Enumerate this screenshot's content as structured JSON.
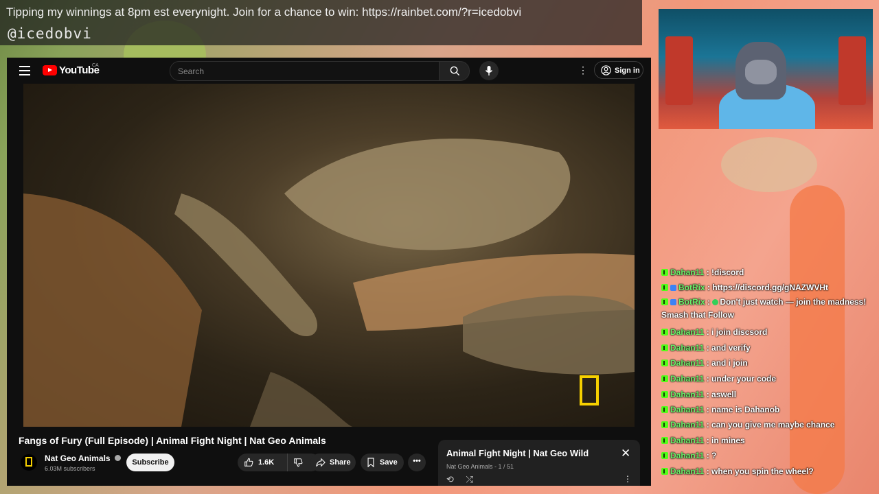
{
  "overlay": {
    "banner_line1": "Tipping my winnings at 8pm est everynight. Join for a chance to win: https://rainbet.com/?r=icedobvi",
    "banner_line2": "@icedobvi"
  },
  "youtube": {
    "logo_text": "YouTube",
    "region": "CA",
    "search_placeholder": "Search",
    "sign_in": "Sign in",
    "video_title": "Fangs of Fury (Full Episode) | Animal Fight Night | Nat Geo Animals",
    "channel_name": "Nat Geo Animals",
    "subscribers": "6.03M subscribers",
    "subscribe_label": "Subscribe",
    "like_count": "1.6K",
    "share_label": "Share",
    "save_label": "Save",
    "playlist": {
      "title": "Animal Fight Night | Nat Geo Wild",
      "subtitle": "Nat Geo Animals - 1 / 51"
    }
  },
  "chat": {
    "messages": [
      {
        "user": "Dahan11",
        "text": ": !discord"
      },
      {
        "user": "BotRix",
        "text": ": https://discord.gg/gNAZWVHt",
        "bot": true
      },
      {
        "user": "BotRix",
        "text": "Don't just watch — join the madness! Smash that Follow",
        "bot": true,
        "heart": true
      },
      {
        "user": "Dahan11",
        "text": ": i join discsord"
      },
      {
        "user": "Dahan11",
        "text": ": and verify"
      },
      {
        "user": "Dahan11",
        "text": ": and i join"
      },
      {
        "user": "Dahan11",
        "text": ": under your code"
      },
      {
        "user": "Dahan11",
        "text": ": aswell"
      },
      {
        "user": "Dahan11",
        "text": ": name is Dahanob"
      },
      {
        "user": "Dahan11",
        "text": ": can you give me maybe chance"
      },
      {
        "user": "Dahan11",
        "text": ": in mines"
      },
      {
        "user": "Dahan11",
        "text": ": ?"
      },
      {
        "user": "Dahan11",
        "text": ": when you spin the wheel?"
      }
    ]
  },
  "colors": {
    "accent_red": "#ff0000",
    "chat_username": "#6af26a",
    "kick_badge": "#53fc18",
    "natgeo_yellow": "#f6d000"
  },
  "icons": [
    "menu-icon",
    "search-icon",
    "mic-icon",
    "more-vert-icon",
    "account-icon",
    "verified-icon",
    "thumb-up-icon",
    "thumb-down-icon",
    "share-icon",
    "save-icon",
    "more-horiz-icon",
    "close-icon",
    "loop-icon",
    "shuffle-icon"
  ]
}
